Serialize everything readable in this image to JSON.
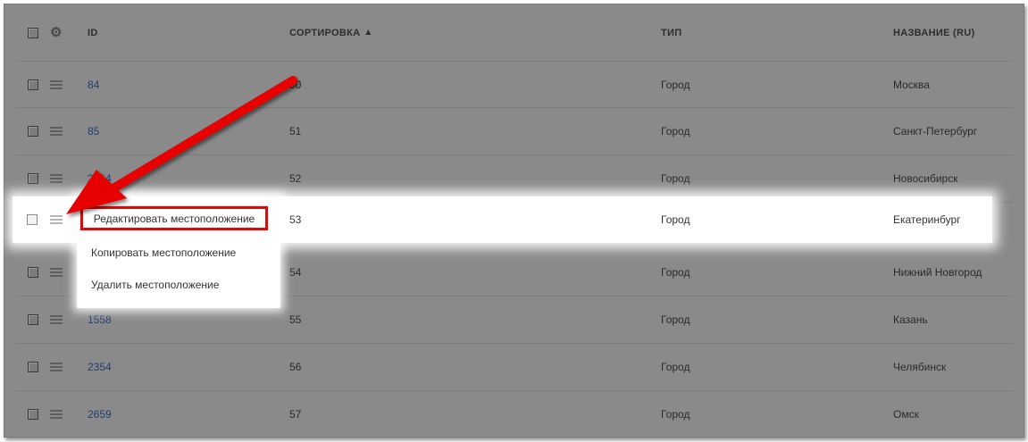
{
  "header": {
    "id": "ID",
    "sort": "СОРТИРОВКА",
    "sort_arrow": "^",
    "type": "ТИП",
    "name": "НАЗВАНИЕ (RU)"
  },
  "rows": [
    {
      "id": "84",
      "sort": "50",
      "type": "Город",
      "name": "Москва"
    },
    {
      "id": "85",
      "sort": "51",
      "type": "Город",
      "name": "Санкт-Петербург"
    },
    {
      "id": "2614",
      "sort": "52",
      "type": "Город",
      "name": "Новосибирск"
    },
    {
      "id": "",
      "sort": "53",
      "type": "Город",
      "name": "Екатеринбург"
    },
    {
      "id": "",
      "sort": "54",
      "type": "Город",
      "name": "Нижний Новгород"
    },
    {
      "id": "1558",
      "sort": "55",
      "type": "Город",
      "name": "Казань"
    },
    {
      "id": "2354",
      "sort": "56",
      "type": "Город",
      "name": "Челябинск"
    },
    {
      "id": "2659",
      "sort": "57",
      "type": "Город",
      "name": "Омск"
    }
  ],
  "menu": {
    "edit": "Редактировать местоположение",
    "copy": "Копировать местоположение",
    "delete": "Удалить местоположение"
  },
  "colors": {
    "overlay": "#8a8a8a",
    "highlight_border": "#dd0a0a",
    "link": "#213f6b"
  }
}
